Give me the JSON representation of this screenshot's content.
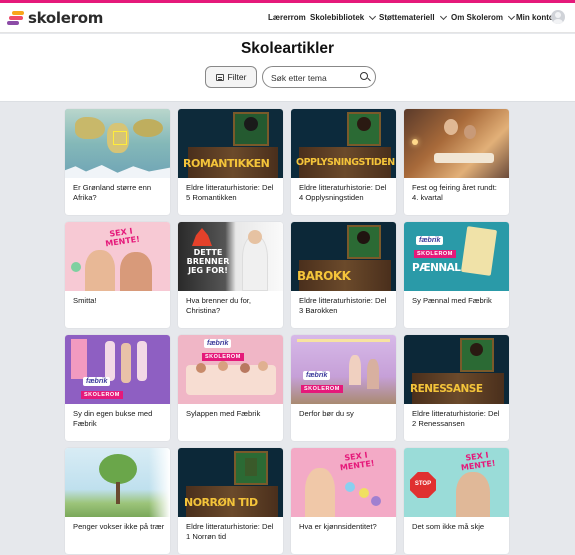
{
  "header": {
    "logo_text": "skolerom",
    "nav": [
      {
        "label": "Lærerrom",
        "dropdown": false
      },
      {
        "label": "Skolebibliotek",
        "dropdown": true
      },
      {
        "label": "Støttemateriell",
        "dropdown": true
      },
      {
        "label": "Om Skolerom",
        "dropdown": true
      },
      {
        "label": "Min konto",
        "dropdown": false
      }
    ],
    "accent_color": "#e5197a"
  },
  "page": {
    "title": "Skoleartikler",
    "filter_label": "Filter",
    "search_placeholder": "Søk etter tema"
  },
  "cards": [
    {
      "title": "Er Grønland større enn Afrika?",
      "thumb": "map"
    },
    {
      "title": "Eldre litteraturhistorie: Del 5 Romantikken",
      "thumb": "era",
      "overlay_text": "ROMANTIKKEN"
    },
    {
      "title": "Eldre litteraturhistorie: Del 4 Opplysningstiden",
      "thumb": "era",
      "overlay_text": "OPPLYSNINGSTIDEN"
    },
    {
      "title": "Fest og feiring året rundt: 4. kvartal",
      "thumb": "photo-warm"
    },
    {
      "title": "Smitta!",
      "thumb": "sex-i-mente",
      "overlay_text": "SEX I MENTE!"
    },
    {
      "title": "Hva brenner du for, Christina?",
      "thumb": "dette-brenner",
      "overlay_text": "DETTE BRENNER JEG FOR!"
    },
    {
      "title": "Eldre litteraturhistorie: Del 3 Barokken",
      "thumb": "era",
      "overlay_text": "BAROKK"
    },
    {
      "title": "Sy Pænnal med Fæbrik",
      "thumb": "fabrik-teal",
      "overlay_text": "PÆNNAL"
    },
    {
      "title": "Sy din egen bukse med Fæbrik",
      "thumb": "fabrik-purple"
    },
    {
      "title": "Sylappen med Fæbrik",
      "thumb": "fabrik-pink"
    },
    {
      "title": "Derfor bør du sy",
      "thumb": "fabrik-lilac"
    },
    {
      "title": "Eldre litteraturhistorie: Del 2 Renessansen",
      "thumb": "era",
      "overlay_text": "RENESSANSE"
    },
    {
      "title": "Penger vokser ikke på trær",
      "thumb": "tree"
    },
    {
      "title": "Eldre litteraturhistorie: Del 1 Norrøn tid",
      "thumb": "era",
      "overlay_text": "NORRØN TID"
    },
    {
      "title": "Hva er kjønnsidentitet?",
      "thumb": "sex-i-mente-2",
      "overlay_text": "SEX I MENTE!"
    },
    {
      "title": "Det som ikke må skje",
      "thumb": "stop",
      "overlay_text": "SEX I MENTE!"
    }
  ],
  "badges": {
    "fabrik": "fæbrik",
    "skolerom": "SKOLEROM",
    "stop": "STOP"
  }
}
